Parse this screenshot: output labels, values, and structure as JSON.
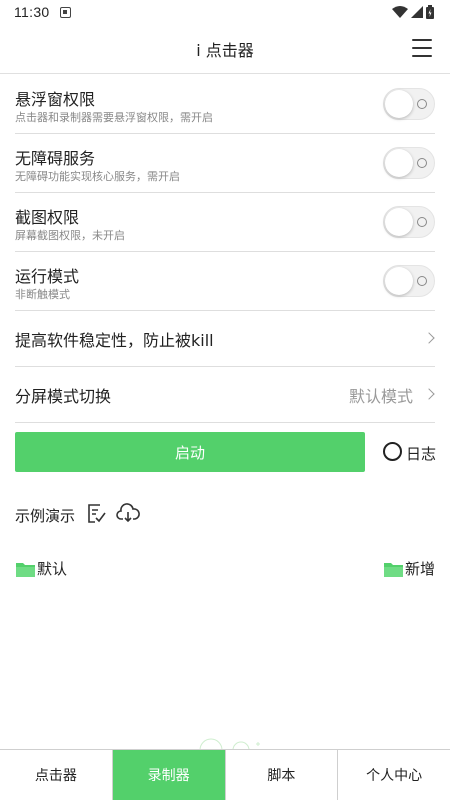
{
  "status_bar": {
    "time": "11:30"
  },
  "app_bar": {
    "title": "i 点击器"
  },
  "permissions": [
    {
      "title": "悬浮窗权限",
      "desc": "点击器和录制器需要悬浮窗权限，需开启",
      "enabled": false
    },
    {
      "title": "无障碍服务",
      "desc": "无障碍功能实现核心服务，需开启",
      "enabled": false
    },
    {
      "title": "截图权限",
      "desc": "屏幕截图权限，未开启",
      "enabled": false
    },
    {
      "title": "运行模式",
      "desc": "非断触模式",
      "enabled": false
    }
  ],
  "stability": {
    "label": "提高软件稳定性，防止被kill"
  },
  "split_screen": {
    "label": "分屏模式切换",
    "value": "默认模式"
  },
  "actions": {
    "start_label": "启动",
    "log_label": "日志"
  },
  "demo": {
    "label": "示例演示",
    "icons": [
      "checklist-edit-icon",
      "cloud-download-icon"
    ]
  },
  "folders": {
    "default_label": "默认",
    "add_label": "新增",
    "folder_color": "#53d06b"
  },
  "tabs": [
    {
      "label": "点击器",
      "active": false
    },
    {
      "label": "录制器",
      "active": true
    },
    {
      "label": "脚本",
      "active": false
    },
    {
      "label": "个人中心",
      "active": false
    }
  ],
  "colors": {
    "accent": "#53d06b",
    "divider": "#dedede",
    "secondary_text": "#888888"
  }
}
